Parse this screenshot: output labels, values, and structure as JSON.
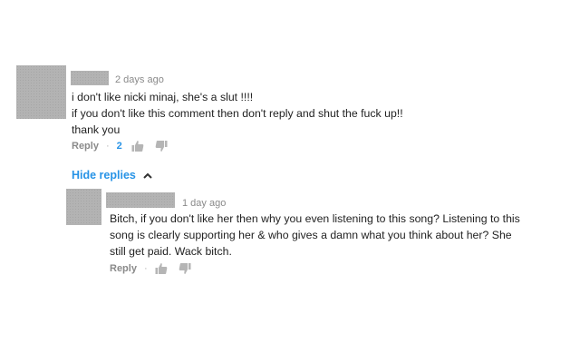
{
  "comment": {
    "time": "2 days ago",
    "lines": [
      "i don't like nicki minaj, she's a slut !!!!",
      "if you don't like this comment then don't reply and shut the fuck up!!",
      "thank you"
    ],
    "reply_label": "Reply",
    "likes": "2",
    "separator": "·"
  },
  "replies_toggle": {
    "label": "Hide replies",
    "icon": "chevron-up-icon"
  },
  "reply": {
    "time": "1 day ago",
    "lines": [
      "Bitch, if you don't like her then why you even listening to this song? Listening to this",
      "song is clearly supporting her & who gives a damn what you think about her? She",
      "still get paid. Wack bitch."
    ],
    "reply_label": "Reply",
    "separator": "·"
  },
  "colors": {
    "link_blue": "#2793e6",
    "meta_gray": "#8a8a8a",
    "redaction_gray": "#b3b3b3"
  }
}
